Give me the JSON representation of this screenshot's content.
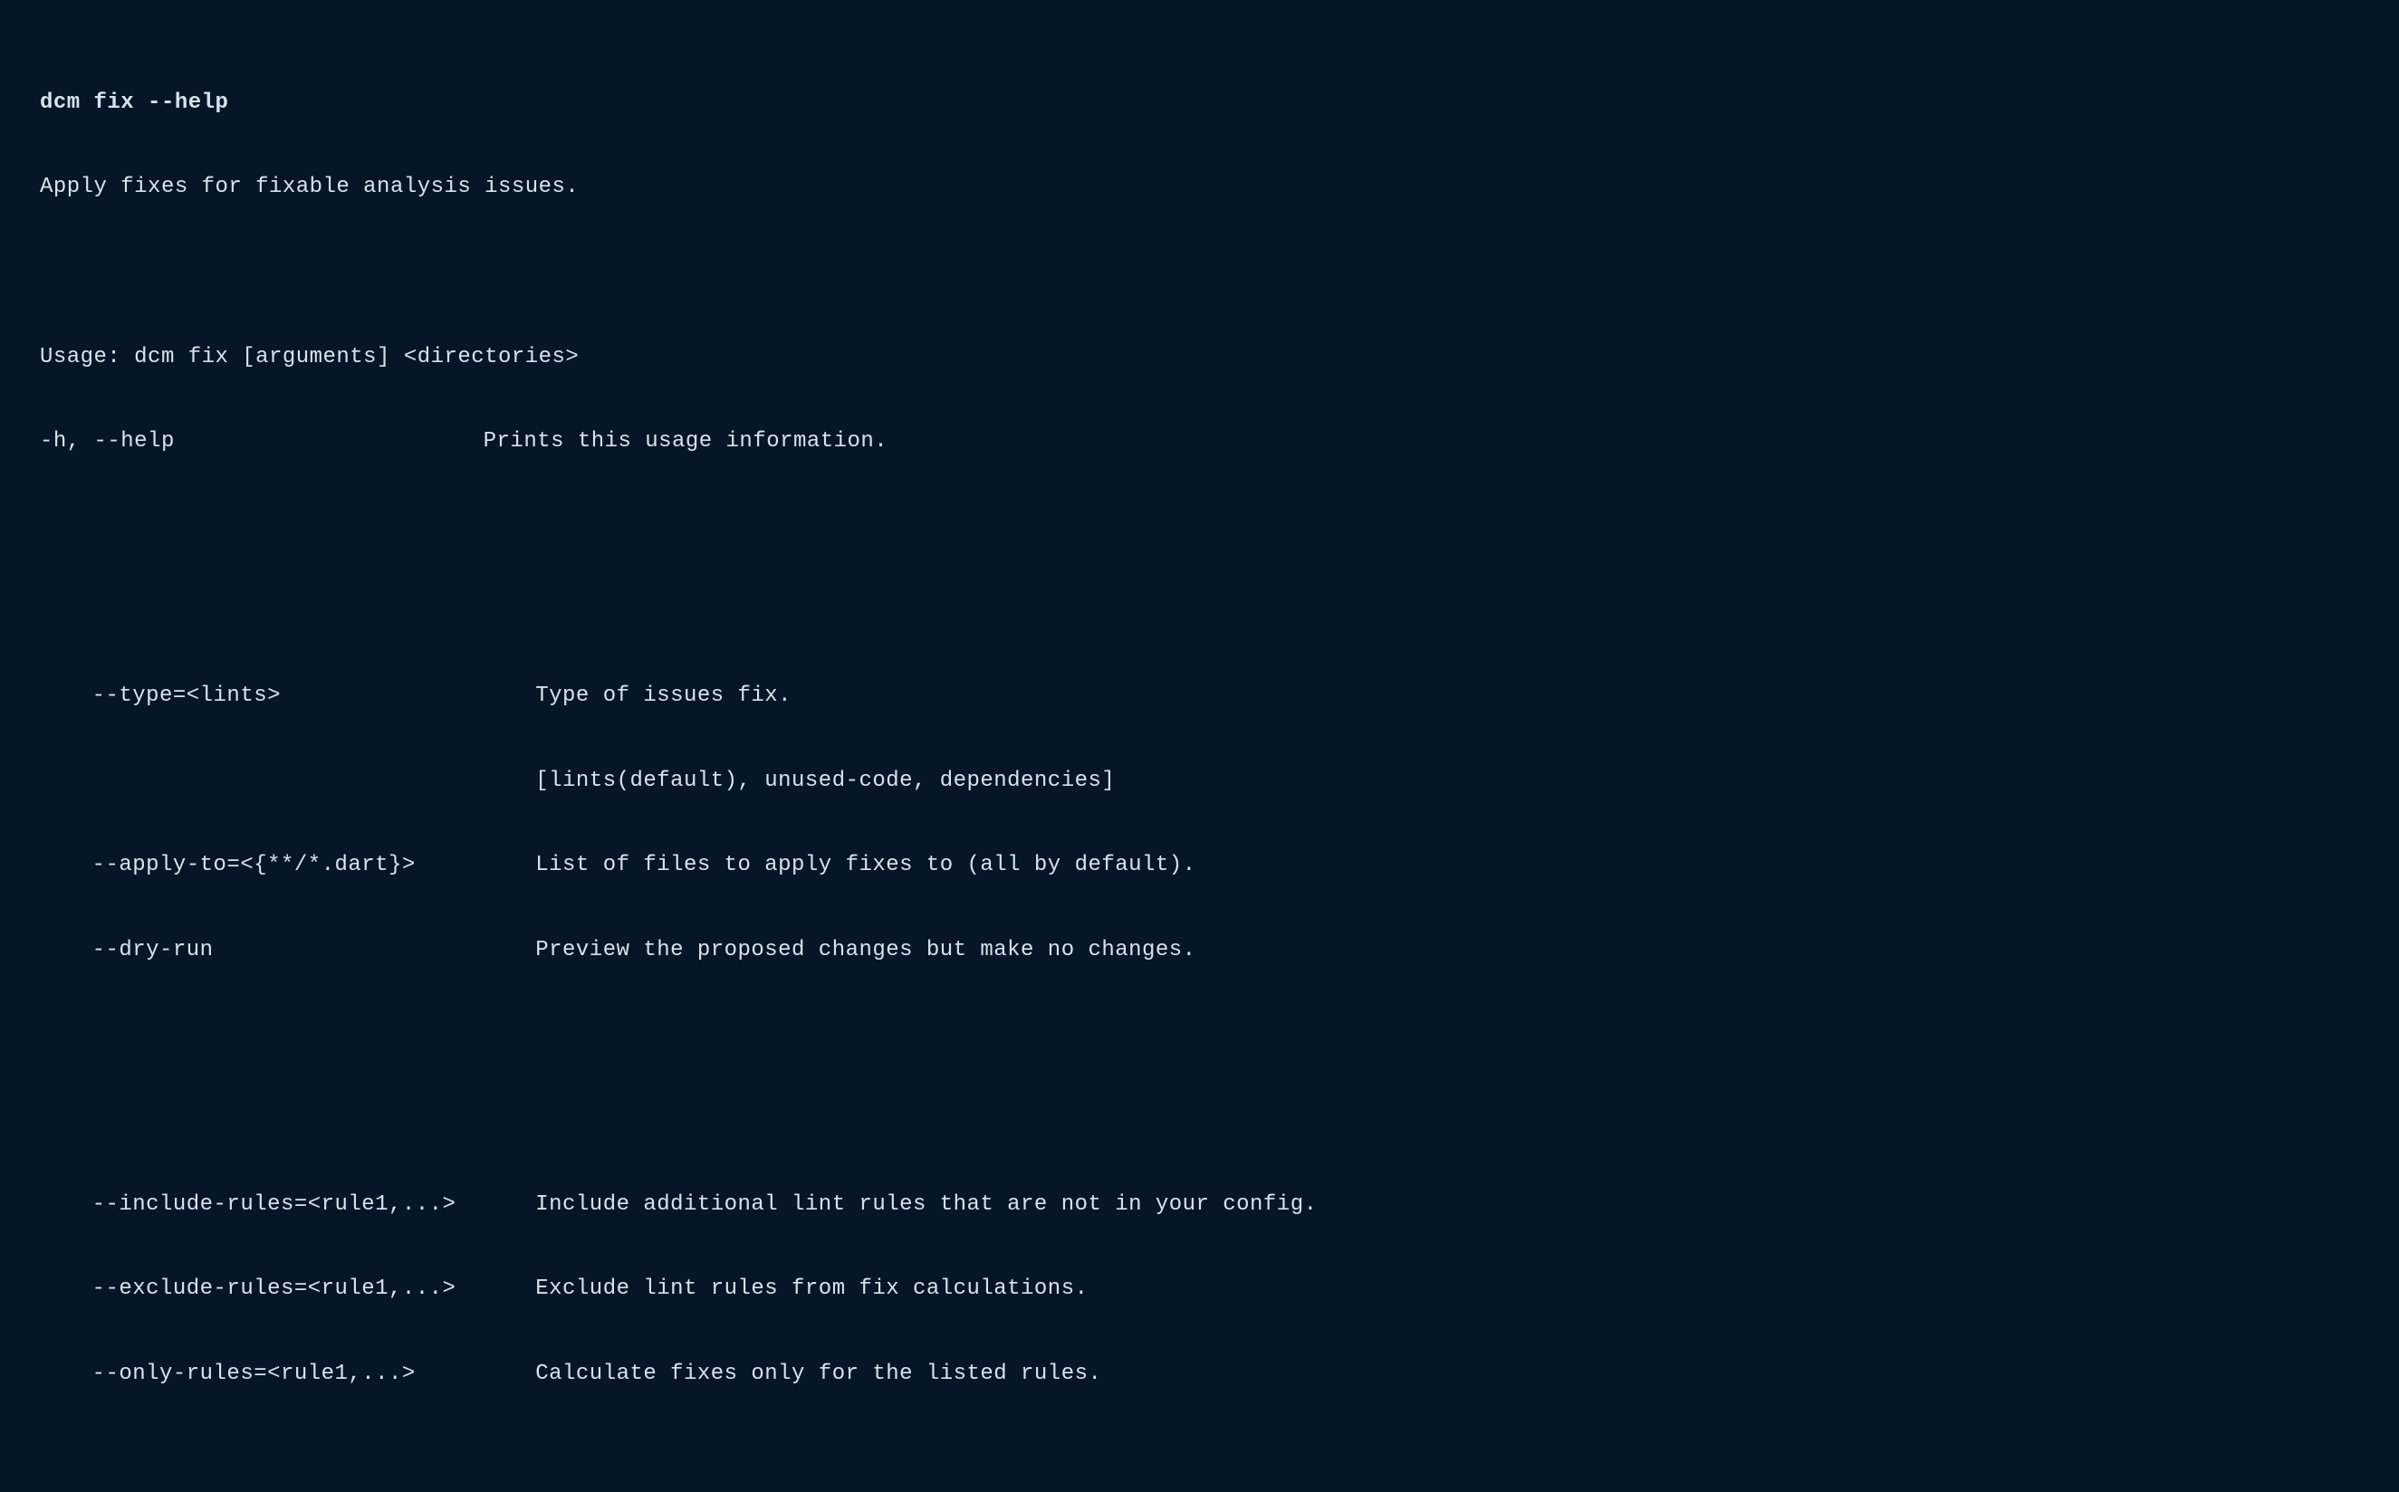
{
  "command": "dcm fix --help",
  "description": "Apply fixes for fixable analysis issues.",
  "usage": "Usage: dcm fix [arguments] <directories>",
  "flags": {
    "help": {
      "flag": "-h, --help",
      "desc": "Prints this usage information."
    },
    "type": {
      "flag": "--type=<lints>",
      "desc": "Type of issues fix."
    },
    "type_values": {
      "flag": "",
      "desc": "[lints(default), unused-code, dependencies]"
    },
    "apply_to": {
      "flag": "--apply-to=<{**/*.dart}>",
      "desc": "List of files to apply fixes to (all by default)."
    },
    "dry_run": {
      "flag": "--dry-run",
      "desc": "Preview the proposed changes but make no changes."
    },
    "include": {
      "flag": "--include-rules=<rule1,...>",
      "desc": "Include additional lint rules that are not in your config."
    },
    "exclude": {
      "flag": "--exclude-rules=<rule1,...>",
      "desc": "Exclude lint rules from fix calculations."
    },
    "only": {
      "flag": "--only-rules=<rule1,...>",
      "desc": "Calculate fixes only for the listed rules."
    }
  }
}
